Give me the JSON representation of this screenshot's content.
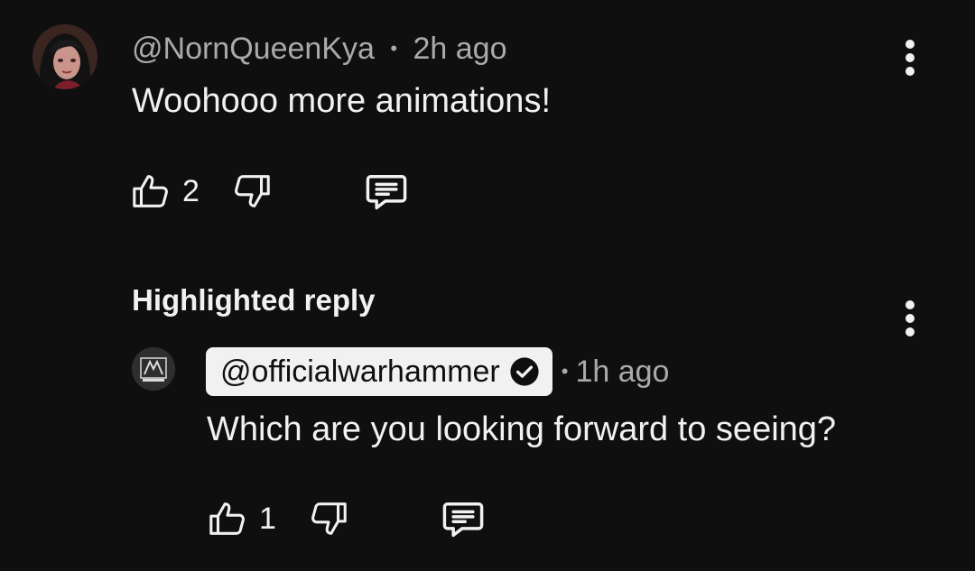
{
  "comment": {
    "author": "@NornQueenKya",
    "separator": "•",
    "time": "2h ago",
    "text": "Woohooo more animations!",
    "like_count": "2"
  },
  "highlight": {
    "label": "Highlighted reply"
  },
  "reply": {
    "author": "@officialwarhammer",
    "separator": "•",
    "time": "1h ago",
    "text": "Which are you looking forward to seeing?",
    "like_count": "1"
  },
  "icons": {
    "more": "more-vertical-icon",
    "like": "thumbs-up-icon",
    "dislike": "thumbs-down-icon",
    "reply": "reply-comment-icon",
    "verified": "verified-check-icon"
  },
  "colors": {
    "background": "#0f0f0f",
    "text_primary": "#f1f1f1",
    "text_secondary": "#aaaaaa",
    "handle_chip_bg": "#f1f1f1"
  }
}
